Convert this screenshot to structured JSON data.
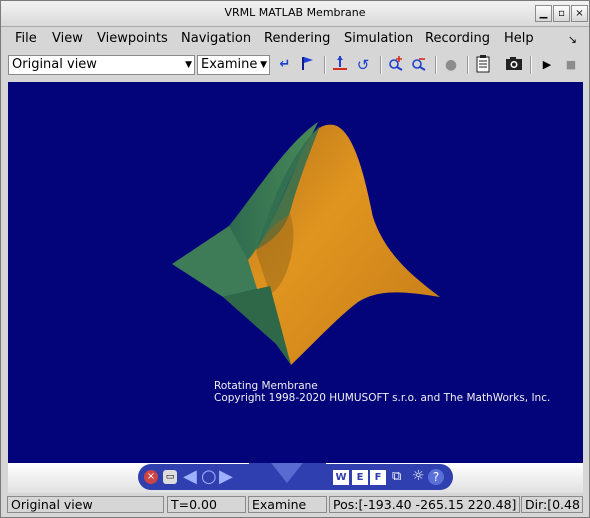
{
  "window": {
    "title": "VRML MATLAB Membrane"
  },
  "menu": {
    "items": [
      {
        "label": "File"
      },
      {
        "label": "View"
      },
      {
        "label": "Viewpoints"
      },
      {
        "label": "Navigation"
      },
      {
        "label": "Rendering"
      },
      {
        "label": "Simulation"
      },
      {
        "label": "Recording"
      },
      {
        "label": "Help"
      }
    ]
  },
  "toolbar": {
    "viewpoint_select": "Original view",
    "navigation_select": "Examine"
  },
  "scene": {
    "caption_line1": "Rotating Membrane",
    "caption_line2": "Copyright 1998-2020 HUMUSOFT s.r.o. and The MathWorks, Inc."
  },
  "navpanel": {
    "w_label": "W",
    "e_label": "E",
    "f_label": "F",
    "help_label": "?"
  },
  "status": {
    "viewpoint": "Original view",
    "time": "T=0.00",
    "mode": "Examine",
    "position": "Pos:[-193.40 -265.15 220.48]",
    "direction": "Dir:[0.48"
  },
  "colors": {
    "viewport_bg": "#03037a",
    "surface_orange": "#d98b1a",
    "surface_green": "#3f7a55",
    "nav_blue": "#2f3fb0"
  }
}
